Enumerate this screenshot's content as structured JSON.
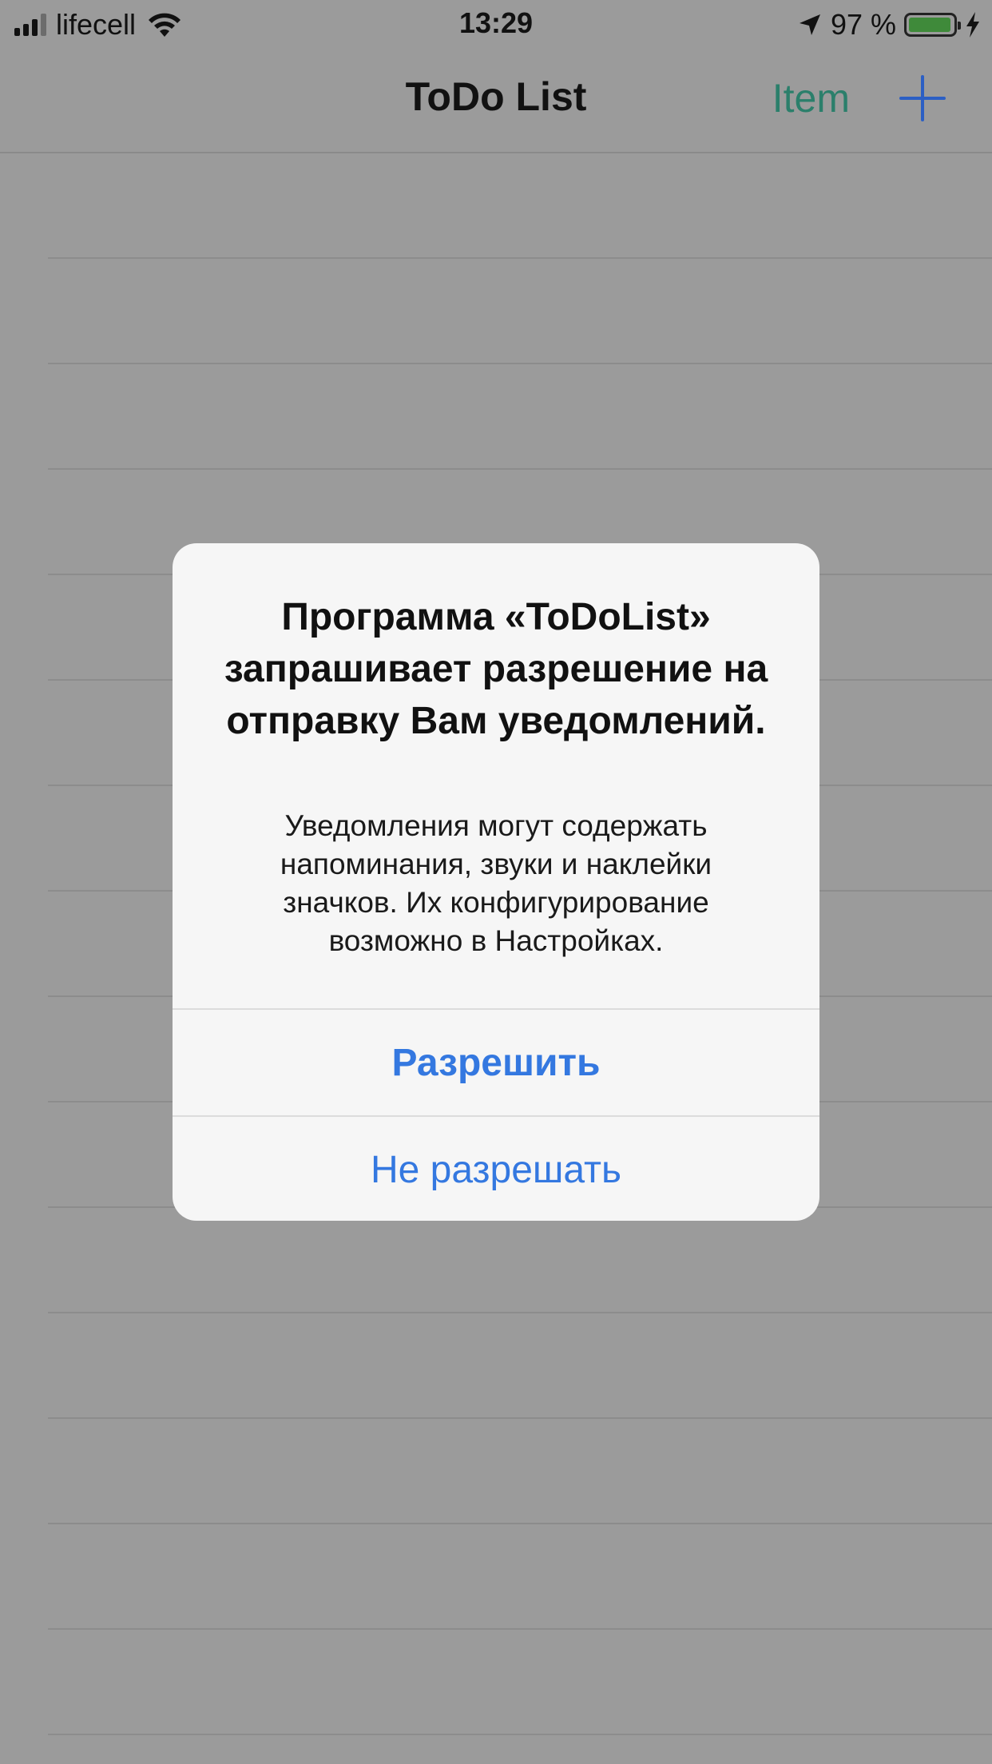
{
  "status_bar": {
    "carrier": "lifecell",
    "time": "13:29",
    "battery_percent": "97 %",
    "battery_level": 0.97,
    "icons": [
      "signal-icon",
      "wifi-icon",
      "location-arrow-icon",
      "battery-icon",
      "charging-bolt-icon"
    ]
  },
  "nav": {
    "title": "ToDo List",
    "item_button": "Item",
    "add_button_icon": "plus-icon"
  },
  "alert": {
    "title": "Программа «ToDoList» запрашивает разрешение на отправку Вам уведомлений.",
    "message": "Уведомления могут содержать напоминания, звуки и наклейки значков. Их конфигурирование возможно в Настройках.",
    "allow_button": "Разрешить",
    "deny_button": "Не разрешать"
  },
  "colors": {
    "accent_blue": "#3478e0",
    "item_green": "#2b7f6b",
    "overlay_gray": "#9b9b9b",
    "battery_green": "#3f8a3a"
  }
}
